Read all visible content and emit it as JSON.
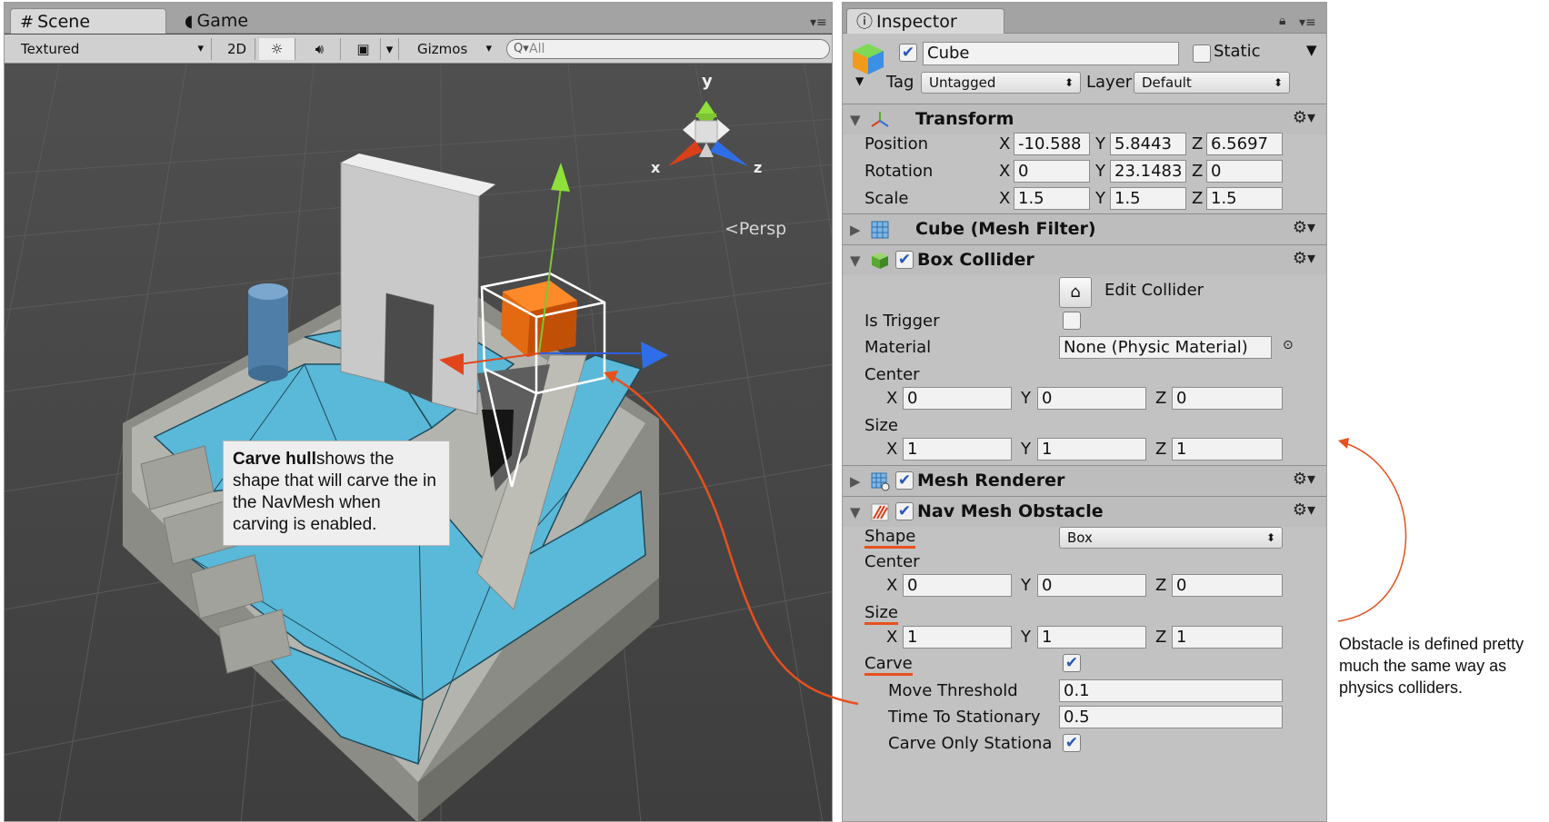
{
  "scene": {
    "tabs": [
      {
        "label": "Scene",
        "icon": "grid-icon"
      },
      {
        "label": "Game",
        "icon": "pacman-icon"
      }
    ],
    "toolbar": {
      "render_mode": "Textured",
      "mode_2d": "2D",
      "gizmos": "Gizmos",
      "search_placeholder": "All"
    },
    "persp_label": "Persp",
    "gizmo_axes": {
      "x": "x",
      "y": "y",
      "z": "z"
    },
    "callout": {
      "bold": "Carve hull",
      "rest": "shows the shape that will carve the in the NavMesh when carving is enabled."
    }
  },
  "inspector": {
    "tab_label": "Inspector",
    "object": {
      "name": "Cube",
      "active": true,
      "static_label": "Static",
      "static": false
    },
    "tag_label": "Tag",
    "tag_value": "Untagged",
    "layer_label": "Layer",
    "layer_value": "Default",
    "transform": {
      "title": "Transform",
      "position_label": "Position",
      "rotation_label": "Rotation",
      "scale_label": "Scale",
      "position": {
        "x": "-10.588",
        "y": "5.8443",
        "z": "6.5697"
      },
      "rotation": {
        "x": "0",
        "y": "23.1483",
        "z": "0"
      },
      "scale": {
        "x": "1.5",
        "y": "1.5",
        "z": "1.5"
      }
    },
    "mesh_filter": {
      "title": "Cube (Mesh Filter)"
    },
    "box_collider": {
      "title": "Box Collider",
      "edit_label": "Edit Collider",
      "is_trigger_label": "Is Trigger",
      "is_trigger": false,
      "material_label": "Material",
      "material_value": "None (Physic Material)",
      "center_label": "Center",
      "center": {
        "x": "0",
        "y": "0",
        "z": "0"
      },
      "size_label": "Size",
      "size": {
        "x": "1",
        "y": "1",
        "z": "1"
      }
    },
    "mesh_renderer": {
      "title": "Mesh Renderer"
    },
    "nav_mesh_obstacle": {
      "title": "Nav Mesh Obstacle",
      "shape_label": "Shape",
      "shape_value": "Box",
      "center_label": "Center",
      "center": {
        "x": "0",
        "y": "0",
        "z": "0"
      },
      "size_label": "Size",
      "size": {
        "x": "1",
        "y": "1",
        "z": "1"
      },
      "carve_label": "Carve",
      "carve": true,
      "move_threshold_label": "Move Threshold",
      "move_threshold": "0.1",
      "time_to_stationary_label": "Time To Stationary",
      "time_to_stationary": "0.5",
      "carve_only_stationary_label": "Carve Only Stationa",
      "carve_only_stationary": true
    },
    "axis_labels": {
      "x": "X",
      "y": "Y",
      "z": "Z"
    }
  },
  "annotation": {
    "text": "Obstacle is defined pretty much the same way as physics colliders."
  },
  "colors": {
    "navmesh": "#5ab8d8",
    "annotation_red": "#e8501d",
    "panel_gray": "#c2c2c2"
  }
}
